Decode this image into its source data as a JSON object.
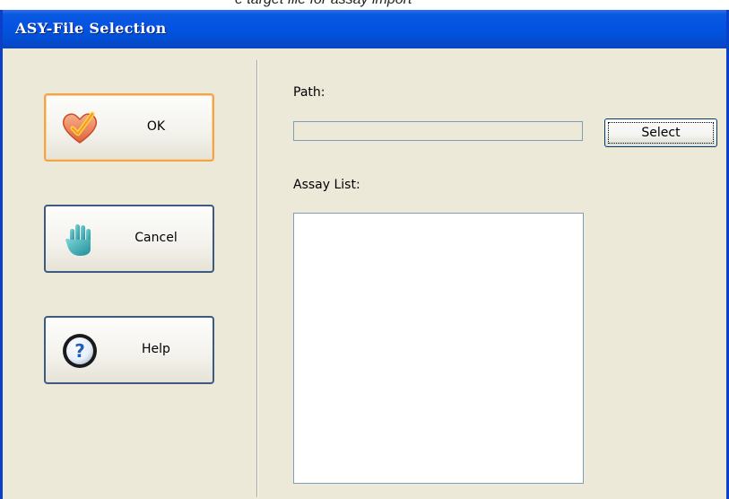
{
  "top_strip_text": "e target file for assay import",
  "window": {
    "title": "ASY-File Selection"
  },
  "buttons": {
    "ok": "OK",
    "cancel": "Cancel",
    "help": "Help"
  },
  "path": {
    "label": "Path:",
    "value": "",
    "select_label": "Select"
  },
  "assay_list": {
    "label": "Assay List:",
    "items": []
  },
  "colors": {
    "titlebar": "#0554e3",
    "face": "#ece9d8",
    "default_button_border": "#f2a44a",
    "button_border": "#3c5a82"
  },
  "icons": {
    "ok": "heart-checkmark-icon",
    "cancel": "stop-hand-icon",
    "help": "question-mark-icon"
  }
}
